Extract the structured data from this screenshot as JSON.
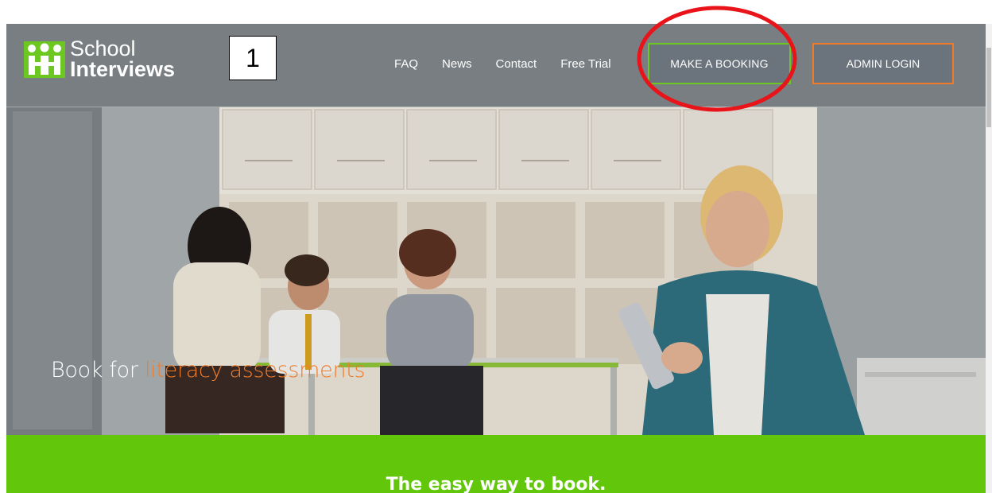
{
  "logo": {
    "line1": "School",
    "line2": "Interviews",
    "mark_colors": [
      "#6cc820",
      "#ffffff"
    ]
  },
  "annotation": {
    "step_number": "1",
    "highlight_color": "#e8141a"
  },
  "nav": {
    "items": [
      {
        "label": "FAQ"
      },
      {
        "label": "News"
      },
      {
        "label": "Contact"
      },
      {
        "label": "Free Trial"
      }
    ]
  },
  "buttons": {
    "booking": "MAKE A BOOKING",
    "admin": "ADMIN LOGIN"
  },
  "hero": {
    "tagline_prefix": "Book for ",
    "tagline_highlight": "literacy assessments"
  },
  "band": {
    "title": "The easy way to book."
  },
  "colors": {
    "brand_green": "#62c70a",
    "accent_orange": "#f07c2a",
    "header_gray": "#767c80"
  }
}
